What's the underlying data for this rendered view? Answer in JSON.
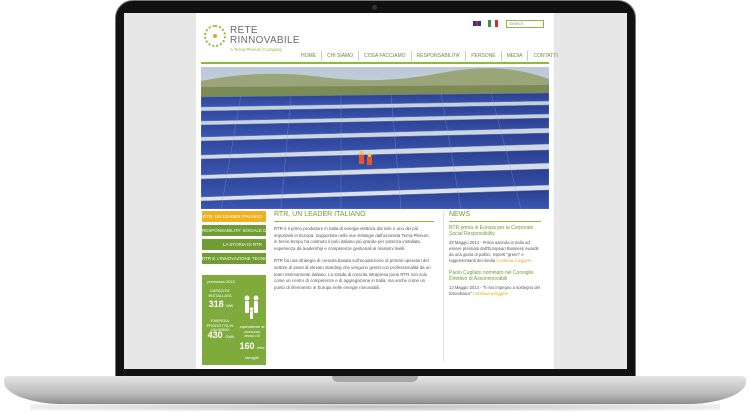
{
  "header": {
    "brand_line1": "RETE",
    "brand_line2": "RINNOVABILE",
    "brand_tagline": "A Terna Plenum Company",
    "search_placeholder": "Search"
  },
  "nav": {
    "items": [
      "HOME",
      "CHI SIAMO",
      "COSA FACCIAMO",
      "RESPONSABILITA'",
      "PERSONE",
      "MEDIA",
      "CONTATTI"
    ]
  },
  "sidebar": {
    "items": [
      {
        "label": "RTR, UN LEADER ITALIANO",
        "active": true
      },
      {
        "label": "RESPONSABILITA' SOCIALE D'IMPRESA",
        "active": false
      },
      {
        "label": "LA STORIA DI RTR",
        "active": false
      },
      {
        "label": "RTR E L'INNOVAZIONE TECNOLOGICA",
        "active": false
      }
    ]
  },
  "stats": {
    "title": "premessa 2013",
    "capacity_label": "CAPACITA' INSTALLATA",
    "capacity_value": "318",
    "capacity_unit": "MW",
    "energy_label": "ENERGIA PRODOTTA IN UN ANNO",
    "energy_value": "430",
    "energy_unit": "GWh",
    "families_label": "equivalente al consumo annuo di",
    "families_value": "160",
    "families_unit": "mila famiglie"
  },
  "main": {
    "title": "RTR, UN LEADER ITALIANO",
    "para1": "RTR è il primo produttore in Italia di energia elettrica dal sole e uno dei più importanti in Europa. Supportato nelle sue strategie dall'azionista Terna Plenum, in breve tempo ha costruito il polo italiano più grande per potenza installata, esperienza da leadership e competenze gestionali ai massimi livelli.",
    "para2": "RTR ha una strategia di crescita basata sull'acquisizione di primari operatori del settore di asset di elevato standing che vengono gestiti con professionalità da un team internamente italiano. La strada di crescita intrapresa pone RTR non solo come un centro di competenze e di aggregazione in Italia, ma anche come un punto di riferimento in Europa nelle energie rinnovabili."
  },
  "news": {
    "title": "NEWS",
    "items": [
      {
        "headline": "RTR prima in Europa per la Corporate Social Responsibility",
        "body": "28 Maggio 2014 - Prima azienda in Italia ad essere premiata dall'European Business Awards da una giuria di politici, esperti \"green\" e rappresentanti dei media",
        "more": "Continua a leggere"
      },
      {
        "headline": "Paolo Cugliato nominato nel Consiglio Direttivo di Assorinnovabili",
        "body": "13 Maggio 2014 - \"Il mio impegno a sostegno del fotovoltaico\"",
        "more": "Continua a leggere"
      }
    ]
  },
  "colors": {
    "brand_green": "#8cba3a",
    "nav_green": "#6a8d3a",
    "accent_orange": "#f0b120",
    "stats_green": "#7eab3b"
  }
}
